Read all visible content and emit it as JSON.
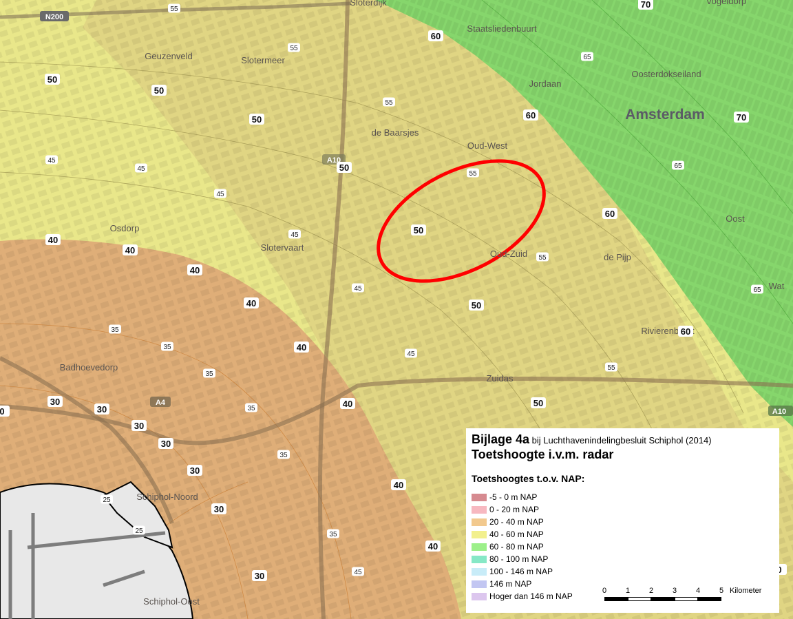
{
  "map": {
    "places": [
      {
        "name": "Sloterdijk",
        "key": "sloterdijk"
      },
      {
        "name": "Staatsliedenbuurt",
        "key": "staatsliedenbuurt"
      },
      {
        "name": "Vogeldorp",
        "key": "vogeldorp"
      },
      {
        "name": "Geuzenveld",
        "key": "geuzenveld"
      },
      {
        "name": "Slotermeer",
        "key": "slotermeer"
      },
      {
        "name": "Oosterdokseiland",
        "key": "oosterdokseiland"
      },
      {
        "name": "Jordaan",
        "key": "jordaan"
      },
      {
        "name": "Amsterdam",
        "key": "amsterdam"
      },
      {
        "name": "de Baarsjes",
        "key": "de-baarsjes"
      },
      {
        "name": "Oud-West",
        "key": "oud-west"
      },
      {
        "name": "Osdorp",
        "key": "osdorp"
      },
      {
        "name": "Slotervaart",
        "key": "slotervaart"
      },
      {
        "name": "Oud-Zuid",
        "key": "oud-zuid"
      },
      {
        "name": "de Pijp",
        "key": "de-pijp"
      },
      {
        "name": "Oost",
        "key": "oost"
      },
      {
        "name": "Wat",
        "key": "wat"
      },
      {
        "name": "Rivierenbuurt",
        "key": "rivierenbuurt"
      },
      {
        "name": "Badhoevedorp",
        "key": "badhoevedorp"
      },
      {
        "name": "Zuidas",
        "key": "zuidas"
      },
      {
        "name": "Schiphol-Noord",
        "key": "schiphol-noord"
      },
      {
        "name": "Schiphol-Oost",
        "key": "schiphol-oost"
      }
    ],
    "roads": [
      "N200",
      "A10",
      "A4",
      "A10"
    ],
    "contour_labels": [
      "70",
      "60",
      "65",
      "70",
      "65",
      "60",
      "55",
      "55",
      "50",
      "50",
      "50",
      "50",
      "45",
      "45",
      "45",
      "45",
      "45",
      "40",
      "40",
      "40",
      "40",
      "40",
      "40",
      "40",
      "35",
      "35",
      "35",
      "35",
      "35",
      "35",
      "30",
      "30",
      "30",
      "30",
      "30",
      "30",
      "30",
      "25",
      "25",
      "60",
      "55",
      "55",
      "55",
      "60",
      "65",
      "50",
      "45",
      "50",
      "55",
      "45",
      "40",
      "50",
      "0",
      "0"
    ],
    "highlight": {
      "color": "#ff0000",
      "shape": "ellipse",
      "area": "Vondelpark / Oud-Zuid"
    },
    "zone_colors": {
      "zone_20_40": "#e8c08a",
      "zone_40_60": "#eaea9a",
      "zone_60_80": "#8fdc7a"
    }
  },
  "legend": {
    "title_strong": "Bijlage 4a",
    "title_rest": "bij Luchthavenindelingbesluit Schiphol (2014)",
    "subtitle": "Toetshoogte i.v.m. radar",
    "heading": "Toetshoogtes t.o.v. NAP:",
    "items": [
      {
        "label": "-5 - 0 m NAP",
        "color": "#d68a90"
      },
      {
        "label": "0 - 20 m NAP",
        "color": "#f7b8c0"
      },
      {
        "label": "20 - 40 m NAP",
        "color": "#f2c98e"
      },
      {
        "label": "40 - 60 m NAP",
        "color": "#f2f08e"
      },
      {
        "label": "60 - 80 m NAP",
        "color": "#9cf08a"
      },
      {
        "label": "80 - 100 m NAP",
        "color": "#86e8c6"
      },
      {
        "label": "100 - 146 m NAP",
        "color": "#c8ecf8"
      },
      {
        "label": "146 m NAP",
        "color": "#c2c6f2"
      },
      {
        "label": "Hoger dan 146 m NAP",
        "color": "#dcc6ee"
      }
    ],
    "scale": {
      "ticks": [
        "0",
        "1",
        "2",
        "3",
        "4",
        "5"
      ],
      "unit": "Kilometer"
    }
  }
}
